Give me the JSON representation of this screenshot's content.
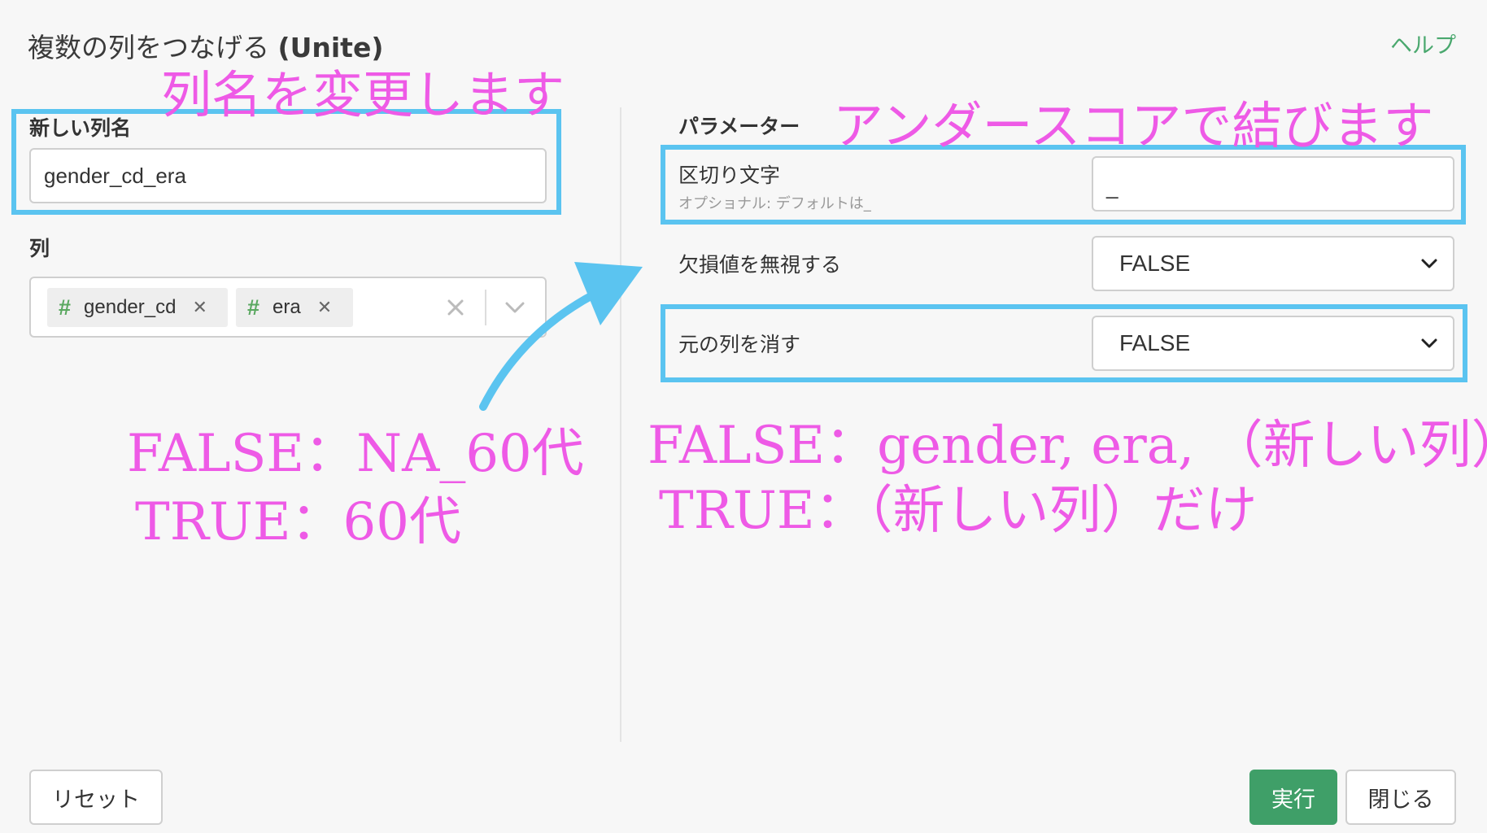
{
  "dialog": {
    "title_prefix": "複数の列をつなげる ",
    "title_suffix": "(Unite)",
    "help_label": "ヘルプ"
  },
  "left": {
    "new_column_label": "新しい列名",
    "new_column_value": "gender_cd_era",
    "columns_label": "列",
    "columns": [
      {
        "icon": "#",
        "name": "gender_cd"
      },
      {
        "icon": "#",
        "name": "era"
      }
    ]
  },
  "right": {
    "parameters_label": "パラメーター",
    "separator": {
      "label": "区切り文字",
      "hint": "オプショナル: デフォルトは_",
      "value": "_"
    },
    "ignore_na": {
      "label": "欠損値を無視する",
      "value": "FALSE"
    },
    "remove_original": {
      "label": "元の列を消す",
      "value": "FALSE"
    }
  },
  "annotations": {
    "rename": "列名を変更します",
    "underscore": "アンダースコアで結びます",
    "na_false": "FALSE：NA_60代",
    "na_true": "TRUE：60代",
    "remove_false": "FALSE：gender, era, （新しい列）",
    "remove_true": "TRUE：（新しい列）だけ"
  },
  "footer": {
    "reset_label": "リセット",
    "run_label": "実行",
    "close_label": "閉じる"
  },
  "colors": {
    "highlight": "#5bc4f0",
    "annotation": "#ee5ae6",
    "primary": "#3f9f68",
    "link": "#4aa86e"
  }
}
